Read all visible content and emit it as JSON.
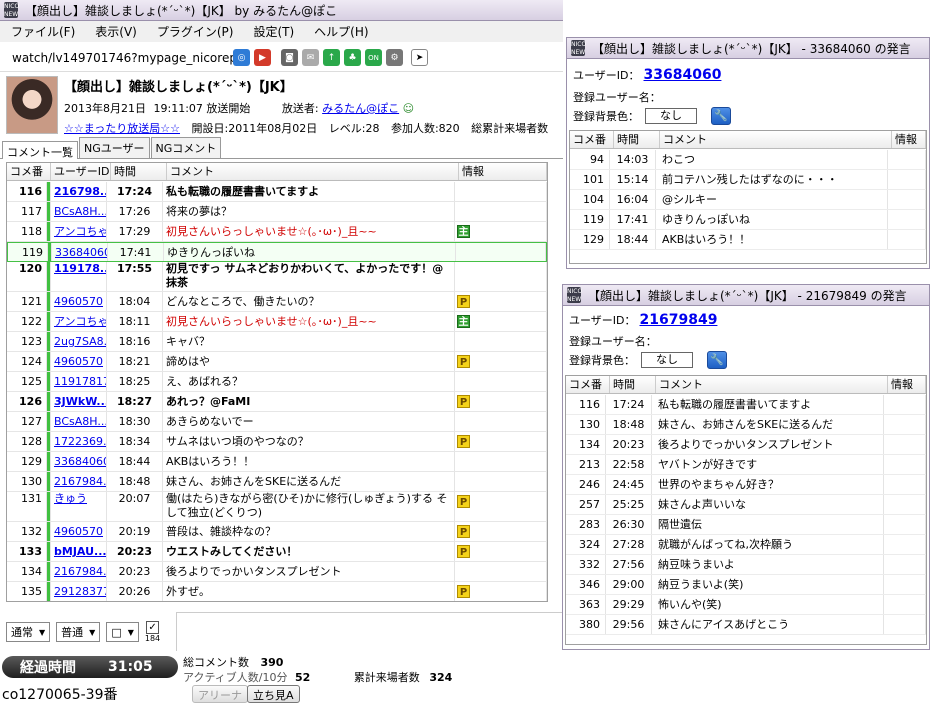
{
  "main": {
    "title": "【顔出し】雑談しましょ(*´ᵕ`*)【JK】 by みるたん@ぽこ",
    "menu": [
      "ファイル(F)",
      "表示(V)",
      "プラグイン(P)",
      "設定(T)",
      "ヘルプ(H)"
    ],
    "url": "watch/lv149701746?mypage_nicorepo",
    "toolbar_icons": [
      "globe-icon",
      "play-icon",
      "camera-icon",
      "mail-icon",
      "upload-icon",
      "tree-icon",
      "on-icon",
      "gear-icon",
      "cursor-icon"
    ],
    "header": {
      "title": "【顔出し】雑談しましょ(*´ᵕ`*)【JK】",
      "start_date": "2013年8月21日",
      "start_time": "19:11:07",
      "start_label": "放送開始",
      "broadcaster_label": "放送者:",
      "broadcaster": "みるたん@ぽこ",
      "community": "☆☆まったり放送局☆☆",
      "founded_label": "開設日:",
      "founded": "2011年08月02日",
      "level_label": "レベル:",
      "level": "28",
      "participants_label": "参加人数:",
      "participants": "820",
      "total_label": "総累計来場者数"
    },
    "tabs": [
      "コメント一覧",
      "NGユーザー",
      "NGコメント"
    ],
    "columns": [
      "コメ番",
      "ユーザーID",
      "時間",
      "コメント",
      "情報"
    ],
    "rows": [
      {
        "no": "116",
        "uid": "216798...",
        "time": "17:24",
        "comment": "私も転職の履歴書書いてますよ",
        "info": "",
        "bar": "#40c040"
      },
      {
        "no": "117",
        "uid": "BCsA8H...",
        "time": "17:26",
        "comment": "将来の夢は？",
        "info": "",
        "bar": "#40c040"
      },
      {
        "no": "118",
        "uid": "アンコちゃ...",
        "time": "17:29",
        "comment": "初見さんいらっしゃいませ☆(｡･ω･)_且~~",
        "info": "主",
        "bar": "#40c040"
      },
      {
        "no": "119",
        "uid": "33684060",
        "time": "17:41",
        "comment": "ゆきりんっぽいね",
        "info": "",
        "bar": "#40c040"
      },
      {
        "no": "120",
        "uid": "119178...",
        "time": "17:55",
        "comment": "初見ですっ サムネどおりかわいくて、よかったです！@抹茶",
        "info": "",
        "bar": "#40c040"
      },
      {
        "no": "121",
        "uid": "4960570",
        "time": "18:04",
        "comment": "どんなところで、働きたいの？",
        "info": "P",
        "bar": "#40c040"
      },
      {
        "no": "122",
        "uid": "アンコちゃ...",
        "time": "18:11",
        "comment": "初見さんいらっしゃいませ☆(｡･ω･)_且~~",
        "info": "主",
        "bar": "#40c040"
      },
      {
        "no": "123",
        "uid": "2ug7SA8...",
        "time": "18:16",
        "comment": "キャバ？",
        "info": "",
        "bar": "#40c040"
      },
      {
        "no": "124",
        "uid": "4960570",
        "time": "18:21",
        "comment": "諦めはや",
        "info": "P",
        "bar": "#40c040"
      },
      {
        "no": "125",
        "uid": "11917817",
        "time": "18:25",
        "comment": "え、あばれる？",
        "info": "",
        "bar": "#40c040"
      },
      {
        "no": "126",
        "uid": "3JWkW...",
        "time": "18:27",
        "comment": "あれっ？@FaMI",
        "info": "P",
        "bar": "#40c040"
      },
      {
        "no": "127",
        "uid": "BCsA8H...",
        "time": "18:30",
        "comment": "あきらめないでー",
        "info": "",
        "bar": "#40c040"
      },
      {
        "no": "128",
        "uid": "1722369...",
        "time": "18:34",
        "comment": "サムネはいつ頃のやつなの？",
        "info": "P",
        "bar": "#40c040"
      },
      {
        "no": "129",
        "uid": "33684060",
        "time": "18:44",
        "comment": "AKBはいろう！！",
        "info": "",
        "bar": "#40c040"
      },
      {
        "no": "130",
        "uid": "2167984...",
        "time": "18:48",
        "comment": "妹さん、お姉さんをSKEに送るんだ",
        "info": "",
        "bar": "#40c040"
      },
      {
        "no": "131",
        "uid": "きゅう",
        "time": "20:07",
        "comment": "働(はたら)きながら密(ひそ)かに修行(しゅぎょう)する そして独立(どくりつ)",
        "info": "P",
        "bar": "#40c040"
      },
      {
        "no": "132",
        "uid": "4960570",
        "time": "20:19",
        "comment": "普段は、雑談枠なの？",
        "info": "P",
        "bar": "#40c040"
      },
      {
        "no": "133",
        "uid": "bMJAU...",
        "time": "20:23",
        "comment": "ウエストみしてください！",
        "info": "P",
        "bar": "#40c040"
      },
      {
        "no": "134",
        "uid": "2167984...",
        "time": "20:23",
        "comment": "後ろよりでっかいタンスプレゼント",
        "info": "",
        "bar": "#40c040"
      },
      {
        "no": "135",
        "uid": "29128377",
        "time": "20:26",
        "comment": "外すぜ。",
        "info": "P",
        "bar": "#40c040"
      }
    ],
    "controls": {
      "mode1": "通常",
      "mode2": "普通",
      "mode3": "□",
      "check_label": "184"
    },
    "elapsed_label": "経過時間",
    "elapsed": "31:05",
    "stats": {
      "total_comments_label": "総コメント数",
      "total_comments": "390",
      "active_label": "アクティブ人数/10分",
      "active": "52",
      "cumulative_label": "累計来場者数",
      "cumulative": "324"
    },
    "community_id": "co1270065-39番",
    "arena_button": "アリーナ",
    "standing_button": "立ち見A"
  },
  "popup1": {
    "title": "【顔出し】雑談しましょ(*´ᵕ`*)【JK】 - 33684060 の発言",
    "uid_label": "ユーザーID：",
    "uid": "33684060",
    "name_label": "登録ユーザー名：",
    "bg_label": "登録背景色：",
    "bg_value": "なし",
    "columns": [
      "コメ番",
      "時間",
      "コメント",
      "情報"
    ],
    "rows": [
      {
        "no": "94",
        "time": "14:03",
        "comment": "わこつ"
      },
      {
        "no": "101",
        "time": "15:14",
        "comment": "前コテハン残したはずなのに・・・"
      },
      {
        "no": "104",
        "time": "16:04",
        "comment": "@シルキー"
      },
      {
        "no": "119",
        "time": "17:41",
        "comment": "ゆきりんっぽいね"
      },
      {
        "no": "129",
        "time": "18:44",
        "comment": "AKBはいろう！！"
      }
    ]
  },
  "popup2": {
    "title": "【顔出し】雑談しましょ(*´ᵕ`*)【JK】 - 21679849 の発言",
    "uid_label": "ユーザーID：",
    "uid": "21679849",
    "name_label": "登録ユーザー名：",
    "bg_label": "登録背景色：",
    "bg_value": "なし",
    "columns": [
      "コメ番",
      "時間",
      "コメント",
      "情報"
    ],
    "rows": [
      {
        "no": "116",
        "time": "17:24",
        "comment": "私も転職の履歴書書いてますよ"
      },
      {
        "no": "130",
        "time": "18:48",
        "comment": "妹さん、お姉さんをSKEに送るんだ"
      },
      {
        "no": "134",
        "time": "20:23",
        "comment": "後ろよりでっかいタンスプレゼント"
      },
      {
        "no": "213",
        "time": "22:58",
        "comment": "ヤバトンが好きです"
      },
      {
        "no": "246",
        "time": "24:45",
        "comment": "世界のやまちゃん好き？"
      },
      {
        "no": "257",
        "time": "25:25",
        "comment": "妹さんよ声いいな"
      },
      {
        "no": "283",
        "time": "26:30",
        "comment": "隔世遺伝"
      },
      {
        "no": "324",
        "time": "27:28",
        "comment": "就職がんばってね,次枠願う"
      },
      {
        "no": "332",
        "time": "27:56",
        "comment": "納豆味うまいよ"
      },
      {
        "no": "346",
        "time": "29:00",
        "comment": "納豆うまいよ(笑)"
      },
      {
        "no": "363",
        "time": "29:29",
        "comment": "怖いんや(笑)"
      },
      {
        "no": "380",
        "time": "29:56",
        "comment": "妹さんにアイスあげとこう"
      }
    ]
  }
}
